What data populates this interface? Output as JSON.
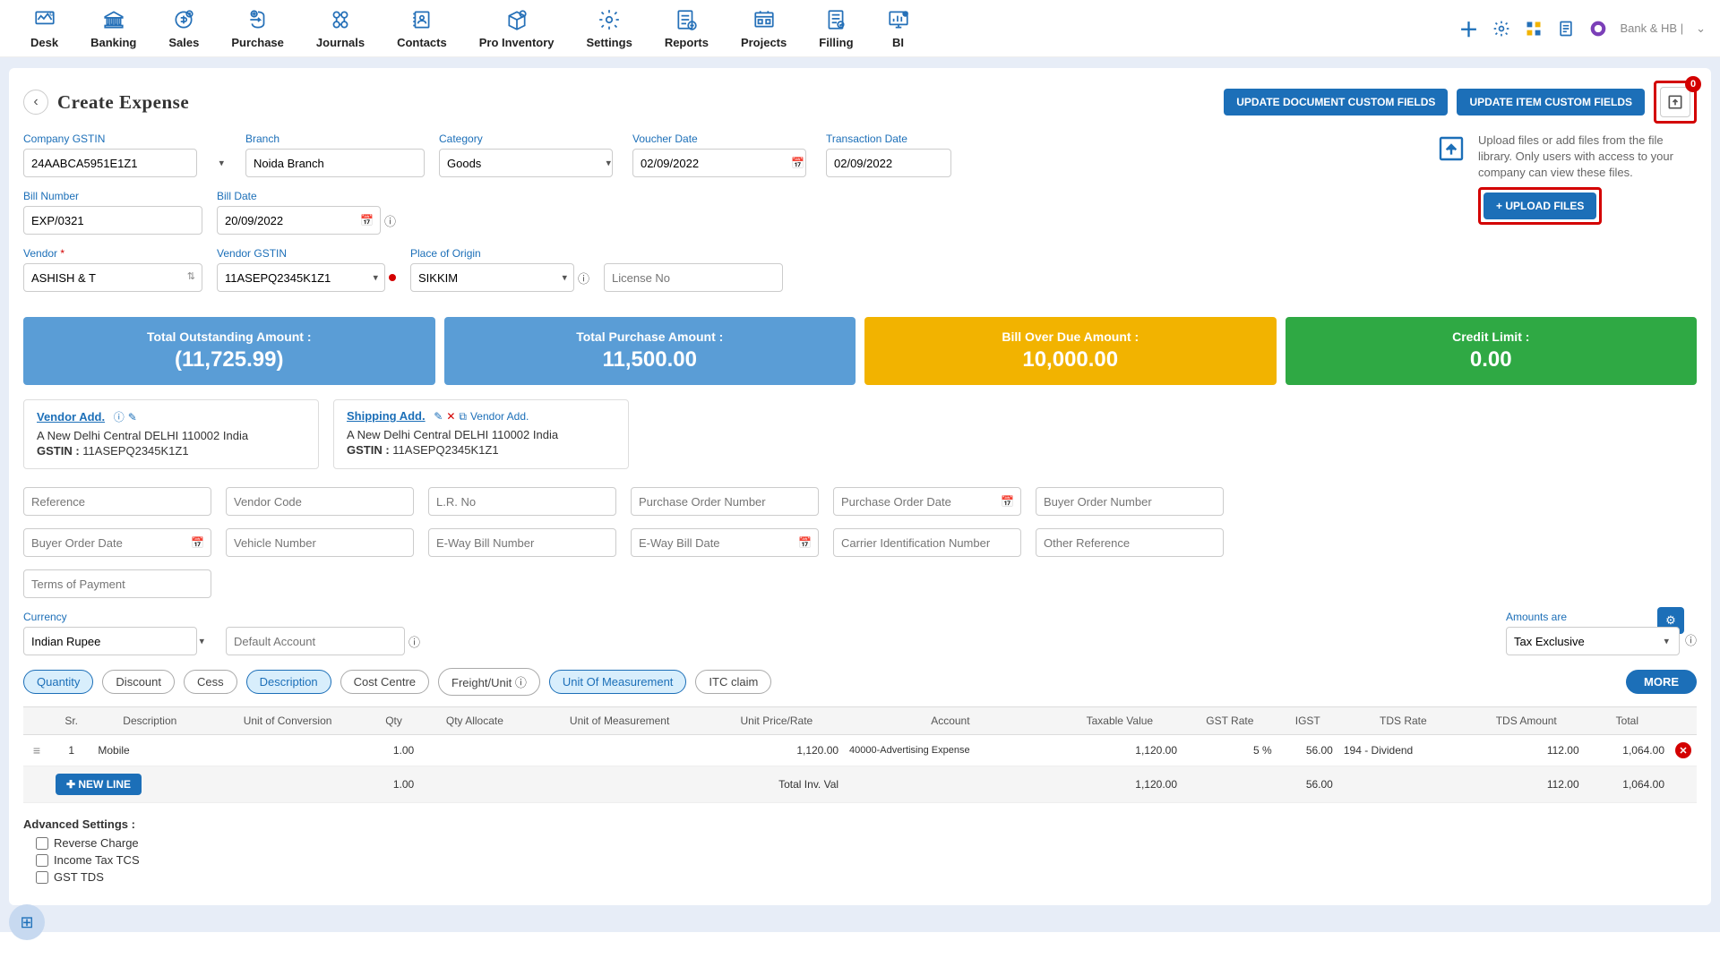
{
  "topnav": {
    "items": [
      "Desk",
      "Banking",
      "Sales",
      "Purchase",
      "Journals",
      "Contacts",
      "Pro Inventory",
      "Settings",
      "Reports",
      "Projects",
      "Filling",
      "BI"
    ],
    "company": "Bank & HB |"
  },
  "page": {
    "title": "Create Expense",
    "btn_update_doc": "UPDATE DOCUMENT CUSTOM FIELDS",
    "btn_update_item": "UPDATE ITEM CUSTOM FIELDS",
    "upload_badge": "0"
  },
  "upload_panel": {
    "desc": "Upload files or add files from the file library. Only users with access to your company can view these files.",
    "btn": "+ UPLOAD FILES"
  },
  "fields": {
    "company_gstin": {
      "label": "Company GSTIN",
      "value": "24AABCA5951E1Z1"
    },
    "branch": {
      "label": "Branch",
      "value": "Noida Branch"
    },
    "category": {
      "label": "Category",
      "value": "Goods"
    },
    "voucher_date": {
      "label": "Voucher Date",
      "value": "02/09/2022"
    },
    "transaction_date": {
      "label": "Transaction Date",
      "value": "02/09/2022"
    },
    "bill_number": {
      "label": "Bill Number",
      "value": "EXP/0321"
    },
    "bill_date": {
      "label": "Bill Date",
      "value": "20/09/2022"
    },
    "vendor": {
      "label": "Vendor",
      "value": "ASHISH & T"
    },
    "vendor_gstin": {
      "label": "Vendor GSTIN",
      "value": "11ASEPQ2345K1Z1"
    },
    "place_of_origin": {
      "label": "Place of Origin",
      "value": "SIKKIM"
    },
    "license_no": {
      "placeholder": "License No"
    }
  },
  "stats": {
    "outstanding": {
      "label": "Total Outstanding Amount :",
      "value": "(11,725.99)"
    },
    "purchase": {
      "label": "Total Purchase Amount :",
      "value": "11,500.00"
    },
    "overdue": {
      "label": "Bill Over Due Amount :",
      "value": "10,000.00"
    },
    "credit": {
      "label": "Credit Limit :",
      "value": "0.00"
    }
  },
  "vendor_addr": {
    "title": "Vendor Add.",
    "line": "A New Delhi Central DELHI 110002 India",
    "gstin_label": "GSTIN :",
    "gstin": "11ASEPQ2345K1Z1"
  },
  "shipping_addr": {
    "title": "Shipping Add.",
    "vendor_link": "Vendor Add.",
    "line": "A New Delhi Central DELHI 110002 India",
    "gstin_label": "GSTIN :",
    "gstin": "11ASEPQ2345K1Z1"
  },
  "meta_fields": {
    "reference": "Reference",
    "vendor_code": "Vendor Code",
    "lr_no": "L.R. No",
    "po_number": "Purchase Order Number",
    "po_date": "Purchase Order Date",
    "buyer_order_number": "Buyer Order Number",
    "buyer_order_date": "Buyer Order Date",
    "vehicle_number": "Vehicle Number",
    "eway_bill_number": "E-Way Bill Number",
    "eway_bill_date": "E-Way Bill Date",
    "carrier_id": "Carrier Identification Number",
    "other_reference": "Other Reference",
    "terms": "Terms of Payment"
  },
  "currency": {
    "label": "Currency",
    "value": "Indian Rupee"
  },
  "default_account": {
    "placeholder": "Default Account"
  },
  "amounts_are": {
    "label": "Amounts are",
    "value": "Tax Exclusive"
  },
  "pills": [
    "Quantity",
    "Discount",
    "Cess",
    "Description",
    "Cost Centre",
    "Freight/Unit",
    "Unit Of Measurement",
    "ITC claim"
  ],
  "pills_active": [
    0,
    3,
    6
  ],
  "more_btn": "MORE",
  "table": {
    "headers": [
      "Sr.",
      "Description",
      "Unit of Conversion",
      "Qty",
      "Qty Allocate",
      "Unit of Measurement",
      "Unit Price/Rate",
      "Account",
      "Taxable Value",
      "GST Rate",
      "IGST",
      "TDS Rate",
      "TDS Amount",
      "Total"
    ],
    "row": {
      "sr": "1",
      "desc": "Mobile",
      "uoc": "",
      "qty": "1.00",
      "qty_alloc": "",
      "uom": "",
      "rate": "1,120.00",
      "account": "40000-Advertising Expense",
      "taxable": "1,120.00",
      "gst": "5 %",
      "igst": "56.00",
      "tds_rate": "194 - Dividend",
      "tds_amt": "112.00",
      "total": "1,064.00"
    },
    "summary": {
      "qty": "1.00",
      "inv_label": "Total Inv. Val",
      "taxable": "1,120.00",
      "igst": "56.00",
      "tds_amt": "112.00",
      "total": "1,064.00"
    },
    "newline": "NEW LINE"
  },
  "advanced": {
    "title": "Advanced Settings :",
    "items": [
      "Reverse Charge",
      "Income Tax TCS",
      "GST TDS"
    ]
  }
}
